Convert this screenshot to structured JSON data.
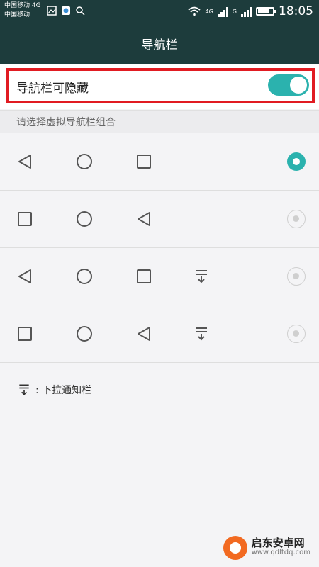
{
  "status_bar": {
    "carrier_line1": "中国移动 4G",
    "carrier_line2": "中国移动",
    "network_4g": "4G",
    "network_g": "G",
    "time": "18:05",
    "icons": [
      "image-icon",
      "app-icon",
      "search-icon",
      "wifi-icon",
      "signal-icon",
      "signal-icon",
      "battery-icon"
    ]
  },
  "title_bar": {
    "title": "导航栏"
  },
  "hide_toggle": {
    "label": "导航栏可隐藏",
    "state": "on",
    "accent_color": "#2bb2ae",
    "highlight_color": "#e11b22"
  },
  "section": {
    "title": "请选择虚拟导航栏组合"
  },
  "combinations": [
    {
      "buttons": [
        "back",
        "home",
        "recent"
      ],
      "selected": true
    },
    {
      "buttons": [
        "recent",
        "home",
        "back"
      ],
      "selected": false
    },
    {
      "buttons": [
        "back",
        "home",
        "recent",
        "notification"
      ],
      "selected": false
    },
    {
      "buttons": [
        "recent",
        "home",
        "back",
        "notification"
      ],
      "selected": false
    }
  ],
  "legend": {
    "icon": "pull-down-notification-icon",
    "text": ": 下拉通知栏"
  },
  "watermark": {
    "title": "启东安卓网",
    "url": "www.qdltdq.com"
  }
}
